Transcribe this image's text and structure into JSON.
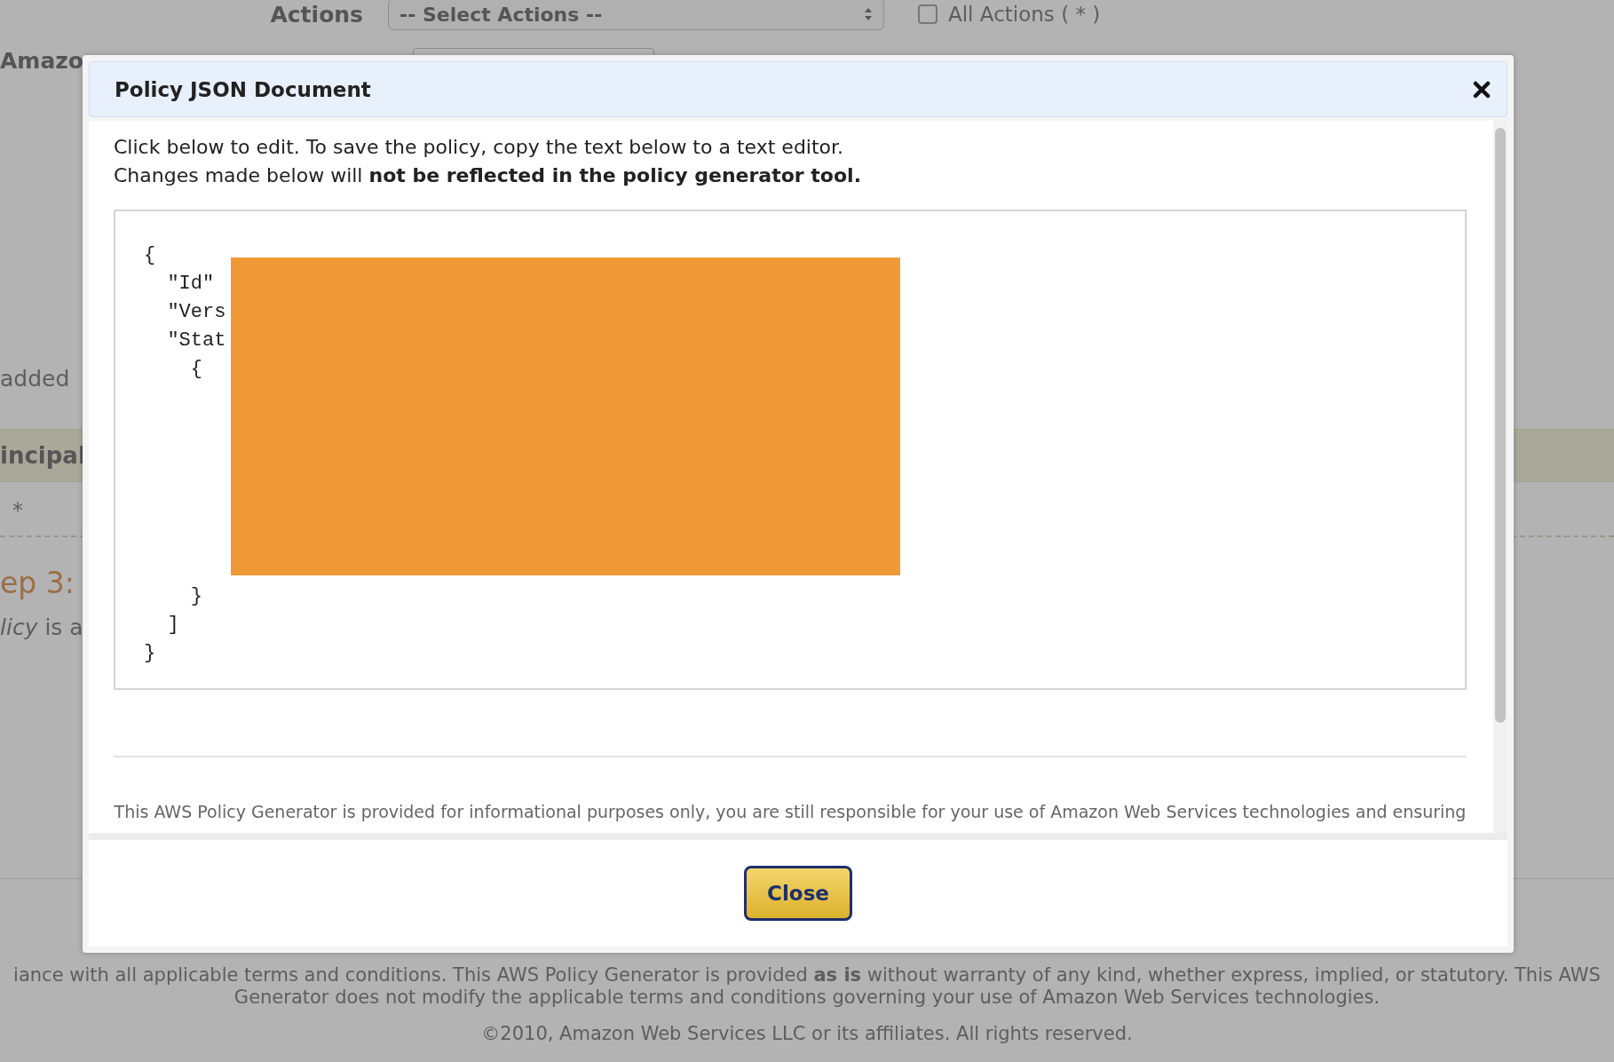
{
  "background": {
    "actions_label": "Actions",
    "actions_select": "-- Select Actions --",
    "all_actions": {
      "label": "All Actions ( * )",
      "checked": false
    },
    "arn_label": "Amazo",
    "note": "added",
    "table_header": "incipal",
    "table_cell": "*",
    "step_heading": "ep 3:",
    "step_text": "*licy* is a",
    "footer_lines": [
      "iance with all applicable terms and conditions. This AWS Policy Generator is provided **as is** without warranty of any kind, whether express, implied, or statutory. This AWS",
      "Generator does not modify the applicable terms and conditions governing your use of Amazon Web Services technologies."
    ],
    "copyright": "©2010, Amazon Web Services LLC or its affiliates. All rights reserved."
  },
  "modal": {
    "title": "Policy JSON Document",
    "intro_lines": [
      "Click below to edit. To save the policy, copy the text below to a text editor.",
      "Changes made below will **not be reflected in the policy generator tool.**"
    ],
    "code_lines_top": [
      "{",
      "  \"Id\"",
      "  \"Vers",
      "  \"Stat",
      "    {"
    ],
    "code_lines_bottom": [
      "    }",
      "  ]",
      "}"
    ],
    "disclaimer": "This AWS Policy Generator is provided for informational purposes only, you are still responsible for your use of Amazon Web Services technologies and ensuring",
    "close_button": "Close"
  }
}
